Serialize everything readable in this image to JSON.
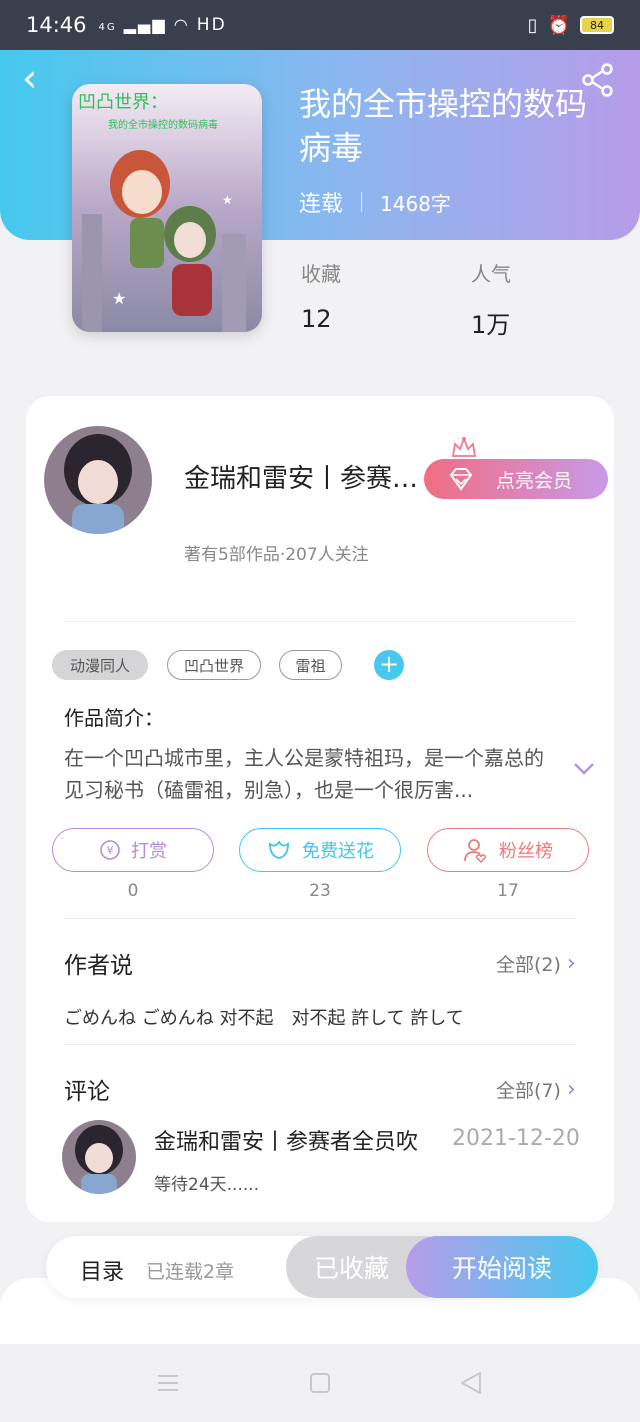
{
  "status_bar": {
    "time": "14:46",
    "network": "4G",
    "hd": "HD",
    "battery": "84"
  },
  "book": {
    "title": "我的全市操控的数码病毒",
    "status": "连载",
    "words": "1468字",
    "cover_title": "凹凸世界：",
    "cover_subtitle": "我的全市操控的数码病毒"
  },
  "stats": [
    {
      "label": "收藏",
      "value": "12"
    },
    {
      "label": "人气",
      "value": "1万"
    }
  ],
  "author": {
    "name": "金瑞和雷安丨参赛者全员吹",
    "meta": "著有5部作品·207人关注",
    "vip_label": "点亮会员"
  },
  "tags": [
    "动漫同人",
    "凹凸世界",
    "雷祖"
  ],
  "intro": {
    "title": "作品简介：",
    "text": "在一个凹凸城市里，主人公是蒙特祖玛，是一个嘉总的见习秘书（磕雷祖，别急），也是一个很厉害..."
  },
  "actions": [
    {
      "label": "打赏",
      "count": "0",
      "color": "#b58be0"
    },
    {
      "label": "免费送花",
      "count": "23",
      "color": "#3fc6ea"
    },
    {
      "label": "粉丝榜",
      "count": "17",
      "color": "#ee7a7a"
    }
  ],
  "author_say": {
    "title": "作者说",
    "more": "全部(2)",
    "text": "ごめんね ごめんね 对不起　对不起 許して 許して"
  },
  "comments": {
    "title": "评论",
    "more": "全部(7)",
    "item": {
      "name": "金瑞和雷安丨参赛者全员吹",
      "date": "2021-12-20",
      "text": "等待24天......"
    }
  },
  "bottom": {
    "toc": "目录",
    "toc_sub": "已连载2章",
    "fav": "已收藏",
    "read": "开始阅读"
  }
}
